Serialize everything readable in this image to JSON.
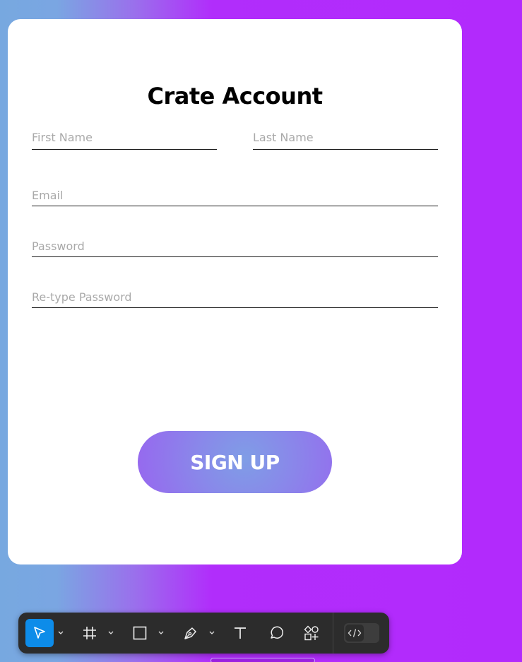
{
  "form": {
    "title": "Crate Account",
    "first_name_placeholder": "First Name",
    "last_name_placeholder": "Last Name",
    "email_placeholder": "Email",
    "password_placeholder": "Password",
    "retype_password_placeholder": "Re-type Password",
    "signup_label": "SIGN UP"
  },
  "toolbar": {
    "tools": [
      {
        "icon": "move-icon",
        "active": true,
        "has_dropdown": true
      },
      {
        "icon": "frame-icon",
        "active": false,
        "has_dropdown": true
      },
      {
        "icon": "rectangle-icon",
        "active": false,
        "has_dropdown": true
      },
      {
        "icon": "pen-icon",
        "active": false,
        "has_dropdown": true
      },
      {
        "icon": "text-icon",
        "active": false,
        "has_dropdown": false
      },
      {
        "icon": "comment-icon",
        "active": false,
        "has_dropdown": false
      },
      {
        "icon": "actions-icon",
        "active": false,
        "has_dropdown": false
      }
    ],
    "dev_mode_icon": "code-icon"
  },
  "colors": {
    "accent": "#0d8ce9",
    "background_left": "#77a8e0",
    "background_right": "#b22afc",
    "button_gradient_center": "#7f9de6",
    "button_gradient_edge": "#9767ef",
    "toolbar": "#2c2c2c"
  }
}
